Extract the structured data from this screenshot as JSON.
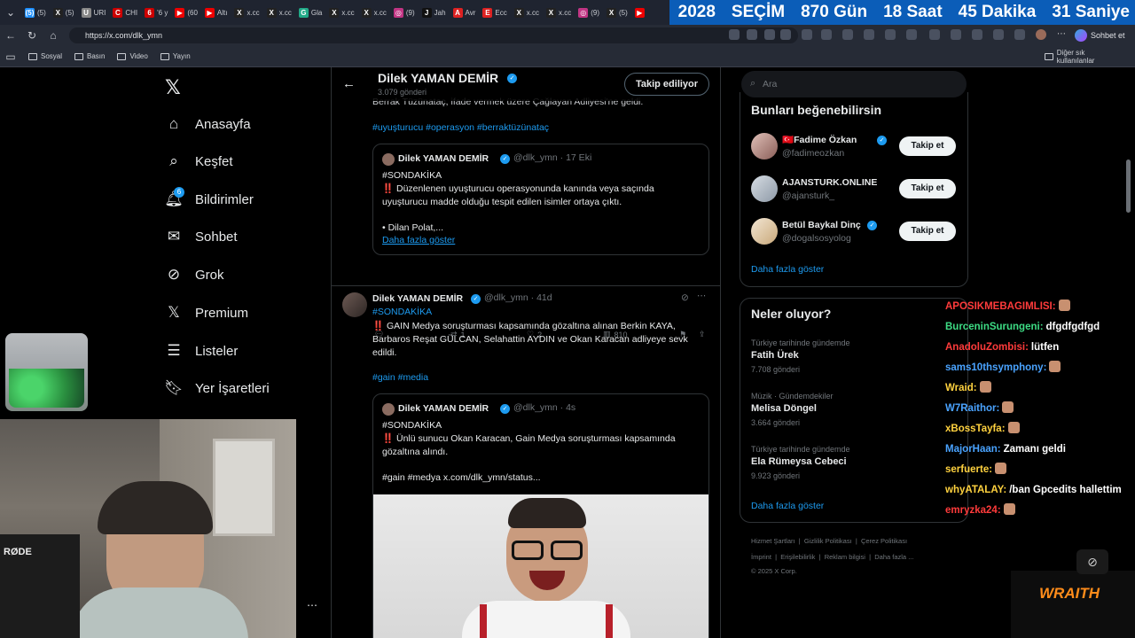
{
  "browser": {
    "tabs": [
      {
        "fav": "(5)",
        "color": "#1e90ff",
        "label": "(5)"
      },
      {
        "fav": "X",
        "color": "#222",
        "label": "(5)"
      },
      {
        "fav": "U",
        "color": "#888",
        "label": "URI"
      },
      {
        "fav": "C",
        "color": "#c00",
        "label": "CHI"
      },
      {
        "fav": "6",
        "color": "#c00",
        "label": "'6 y"
      },
      {
        "fav": "▶",
        "color": "#e00",
        "label": "(60"
      },
      {
        "fav": "▶",
        "color": "#e00",
        "label": "Altı"
      },
      {
        "fav": "X",
        "color": "#222",
        "label": "x.cc"
      },
      {
        "fav": "X",
        "color": "#222",
        "label": "x.cc"
      },
      {
        "fav": "G",
        "color": "#2a8",
        "label": "Gla"
      },
      {
        "fav": "X",
        "color": "#222",
        "label": "x.cc"
      },
      {
        "fav": "X",
        "color": "#222",
        "label": "x.cc"
      },
      {
        "fav": "◎",
        "color": "#c13584",
        "label": "(9)"
      },
      {
        "fav": "J",
        "color": "#111",
        "label": "Jah"
      },
      {
        "fav": "A",
        "color": "#d22",
        "label": "Avr"
      },
      {
        "fav": "E",
        "color": "#d22",
        "label": "Ecc"
      },
      {
        "fav": "X",
        "color": "#222",
        "label": "x.cc"
      },
      {
        "fav": "X",
        "color": "#222",
        "label": "x.cc"
      },
      {
        "fav": "◎",
        "color": "#c13584",
        "label": "(9)"
      },
      {
        "fav": "X",
        "color": "#222",
        "label": "(5)"
      },
      {
        "fav": "▶",
        "color": "#e00",
        "label": ""
      }
    ],
    "banner": [
      "2028",
      "SEÇİM",
      "870 Gün",
      "18 Saat",
      "45 Dakika",
      "31 Saniye"
    ],
    "url": "https://x.com/dlk_ymn",
    "sohbet_label": "Sohbet et",
    "bookmarks": [
      "Sosyal",
      "Basın",
      "Video",
      "Yayın"
    ],
    "other_bookmarks": "Diğer sık kullanılanlar"
  },
  "nav": {
    "items": [
      "Anasayfa",
      "Keşfet",
      "Bildirimler",
      "Sohbet",
      "Grok",
      "Premium",
      "Listeler",
      "Yer İşaretleri"
    ],
    "notif_badge": "6"
  },
  "profile_header": {
    "name": "Dilek YAMAN DEMİR",
    "posts": "3.079 gönderi",
    "follow_state": "Takip ediliyor"
  },
  "tweet1": {
    "text_tail": "Berrak Tüzünataç, ifade vermek üzere Çağlayan Adliyesi'ne geldi.",
    "hashtags": "#uyuşturucu #operasyon #berraktüzünataç",
    "quote": {
      "name": "Dilek YAMAN DEMİR",
      "handle": "@dlk_ymn · 17 Eki",
      "line1": "#SONDAKİKA",
      "line2": "‼️ Düzenlenen uyuşturucu operasyonunda kanında veya saçında",
      "line3": "uyuşturucu madde olduğu tespit edilen isimler ortaya çıktı.",
      "line4": "• Dilan Polat,...",
      "more": "Daha fazla göster"
    },
    "retweets": "1",
    "likes": "2",
    "views": "810"
  },
  "tweet2": {
    "name": "Dilek YAMAN DEMİR",
    "handle": "@dlk_ymn · 41d",
    "line1": "#SONDAKİKA",
    "line2": "‼️ GAIN Medya soruşturması kapsamında gözaltına alınan Berkin KAYA,",
    "line3": "Barbaros Reşat GÜLCAN, Selahattin AYDIN ve Okan Karacan adliyeye sevk",
    "line4": "edildi.",
    "hashtags": "#gain #media",
    "quote": {
      "name": "Dilek YAMAN DEMİR",
      "handle": "@dlk_ymn · 4s",
      "line1": "#SONDAKİKA",
      "line2": "‼️ Ünlü sunucu Okan Karacan, Gain Medya soruşturması kapsamında",
      "line3": "gözaltına alındı.",
      "line4": "#gain #medya  x.com/dlk_ymn/status..."
    }
  },
  "search": {
    "placeholder": "Ara"
  },
  "suggestions": {
    "title": "Bunları beğenebilirsin",
    "users": [
      {
        "name": "🇹🇷Fadime Özkan",
        "handle": "@fadimeozkan",
        "button": "Takip et"
      },
      {
        "name": "AJANSTURK.ONLINE",
        "handle": "@ajansturk_",
        "button": "Takip et"
      },
      {
        "name": "Betül Baykal Dinç",
        "handle": "@dogalsosyolog",
        "button": "Takip et"
      }
    ],
    "more": "Daha fazla göster"
  },
  "trends": {
    "title": "Neler oluyor?",
    "items": [
      {
        "meta": "Türkiye tarihinde gündemde",
        "name": "Fatih Ürek",
        "count": "7.708 gönderi"
      },
      {
        "meta": "Müzik · Gündemdekiler",
        "name": "Melisa Döngel",
        "count": "3.664 gönderi"
      },
      {
        "meta": "Türkiye tarihinde gündemde",
        "name": "Ela Rümeysa Cebeci",
        "count": "9.923 gönderi"
      }
    ],
    "more": "Daha fazla göster"
  },
  "footer": {
    "row1": [
      "Hizmet Şartları",
      "Gizlilik Politikası",
      "Çerez Politikası"
    ],
    "row2": [
      "İmprint",
      "Erişilebilirlik",
      "Reklam bilgisi",
      "Daha fazla ..."
    ],
    "copyright": "© 2025 X Corp."
  },
  "chat": [
    {
      "user": "APOSIKMEBAGIMLISI:",
      "color": "#ff3b3b",
      "msg": ""
    },
    {
      "user": "BurceninSurungeni:",
      "color": "#3ddc84",
      "msg": "dfgdfgdfgd"
    },
    {
      "user": "AnadoluZombisi:",
      "color": "#ff3b3b",
      "msg": "lütfen"
    },
    {
      "user": "sams10thsymphony:",
      "color": "#4aa3ff",
      "msg": ""
    },
    {
      "user": "Wraid:",
      "color": "#ffd23f",
      "msg": ""
    },
    {
      "user": "W7Raithor:",
      "color": "#4aa3ff",
      "msg": ""
    },
    {
      "user": "xBossTayfa:",
      "color": "#ffd23f",
      "msg": ""
    },
    {
      "user": "MajorHaan:",
      "color": "#4aa3ff",
      "msg": "Zamanı geldi"
    },
    {
      "user": "serfuerte:",
      "color": "#ffd23f",
      "msg": ""
    },
    {
      "user": "whyATALAY:",
      "color": "#ffd23f",
      "msg": "/ban Gpcedits hallettim"
    },
    {
      "user": "emryzka24:",
      "color": "#ff3b3b",
      "msg": ""
    }
  ],
  "overlay": {
    "brand": "WRAITH",
    "mic_label": "RØDE"
  },
  "colors": {
    "accent": "#1d9bf0",
    "banner": "#0b5db8",
    "bg": "#000000"
  }
}
